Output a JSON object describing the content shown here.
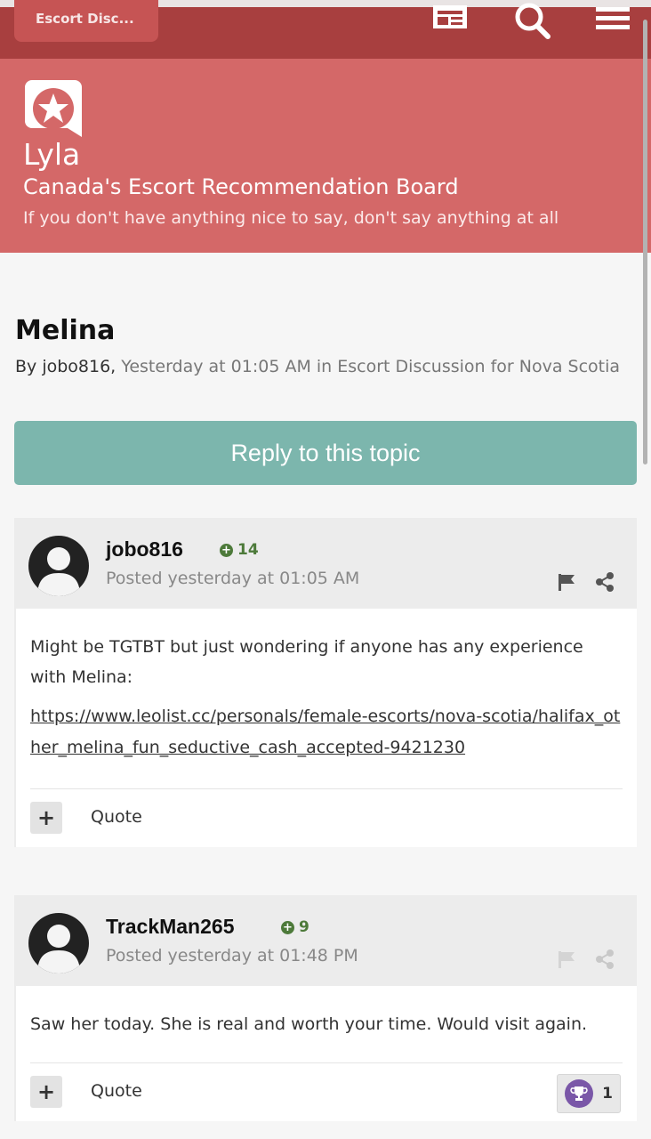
{
  "nav": {
    "back_label": "Escort Disc...",
    "icons": [
      "news-icon",
      "search-icon",
      "menu-icon"
    ]
  },
  "site": {
    "name": "Lyla",
    "subtitle": "Canada's Escort Recommendation Board",
    "tagline": "If you don't have anything nice to say, don't say anything at all"
  },
  "topic": {
    "title": "Melina",
    "by_label": "By jobo816,",
    "meta": "Yesterday at 01:05 AM in Escort Discussion for Nova Scotia",
    "reply_label": "Reply to this topic"
  },
  "posts": [
    {
      "author": "jobo816",
      "reputation": "14",
      "posted": "Posted yesterday at 01:05 AM",
      "text": "Might be TGTBT but just wondering if anyone has any experience with Melina:",
      "link": "https://www.leolist.cc/personals/female-escorts/nova-scotia/halifax_other_melina_fun_seductive_cash_accepted-9421230",
      "quote_label": "Quote"
    },
    {
      "author": "TrackMan265",
      "reputation": "9",
      "posted": "Posted yesterday at 01:48 PM",
      "text": "Saw her today. She is real and worth your time. Would visit again.",
      "quote_label": "Quote",
      "reaction_count": "1"
    }
  ],
  "colors": {
    "nav_bg": "#a83f3f",
    "header_bg": "#d46868",
    "reply_button": "#7cb6ad",
    "reputation": "#4d7a3a",
    "trophy": "#7a57a8"
  }
}
